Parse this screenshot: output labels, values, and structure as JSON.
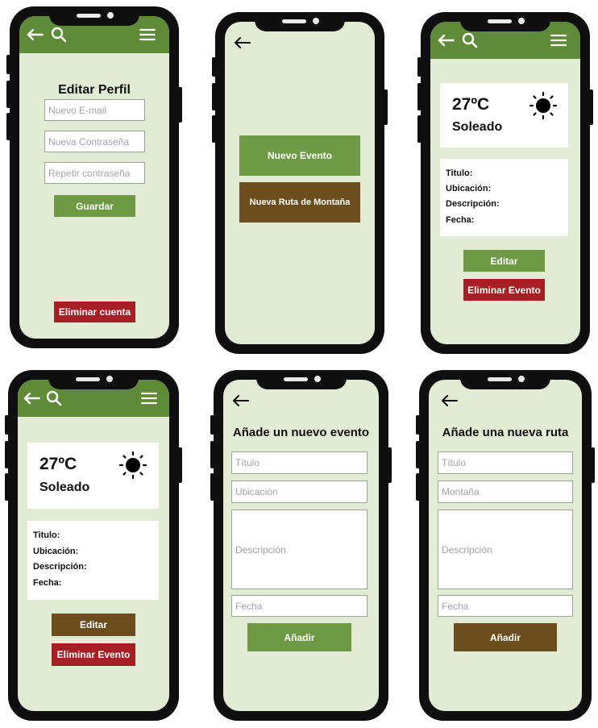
{
  "phones": {
    "edit_profile": {
      "title": "Editar Perfil",
      "email_placeholder": "Nuevo E-mail",
      "password_placeholder": "Nueva Contraseña",
      "repeat_placeholder": "Repetir contraseña",
      "save_label": "Guardar",
      "delete_label": "Eliminar cuenta"
    },
    "new_menu": {
      "new_event_label": "Nuevo Evento",
      "new_route_label": "Nueva Ruta de Montaña"
    },
    "event_green": {
      "temperature": "27ºC",
      "condition": "Soleado",
      "weather_icon": "sun-icon",
      "title_label": "Titulo:",
      "location_label": "Ubicación:",
      "description_label": "Descripción:",
      "date_label": "Fecha:",
      "edit_label": "Editar",
      "delete_label": "Eliminar Evento"
    },
    "event_brown": {
      "temperature": "27ºC",
      "condition": "Soleado",
      "weather_icon": "sun-icon",
      "title_label": "Titulo:",
      "location_label": "Ubicación:",
      "description_label": "Descripción:",
      "date_label": "Fecha:",
      "edit_label": "Editar",
      "delete_label": "Eliminar Evento"
    },
    "add_event": {
      "title": "Añade un nuevo evento",
      "title_placeholder": "Título",
      "location_placeholder": "Ubicación",
      "description_placeholder": "Descripción",
      "date_placeholder": "Fecha",
      "add_label": "Añadir"
    },
    "add_route": {
      "title": "Añade una nueva ruta",
      "title_placeholder": "Título",
      "mountain_placeholder": "Montaña",
      "description_placeholder": "Descripción",
      "date_placeholder": "Fecha",
      "add_label": "Añadir"
    }
  },
  "colors": {
    "header_green": "#5f8a37",
    "screen_bg": "#e2ecd5",
    "button_green": "#6e9a45",
    "button_brown": "#6c4e1e",
    "button_red": "#a51f24"
  }
}
